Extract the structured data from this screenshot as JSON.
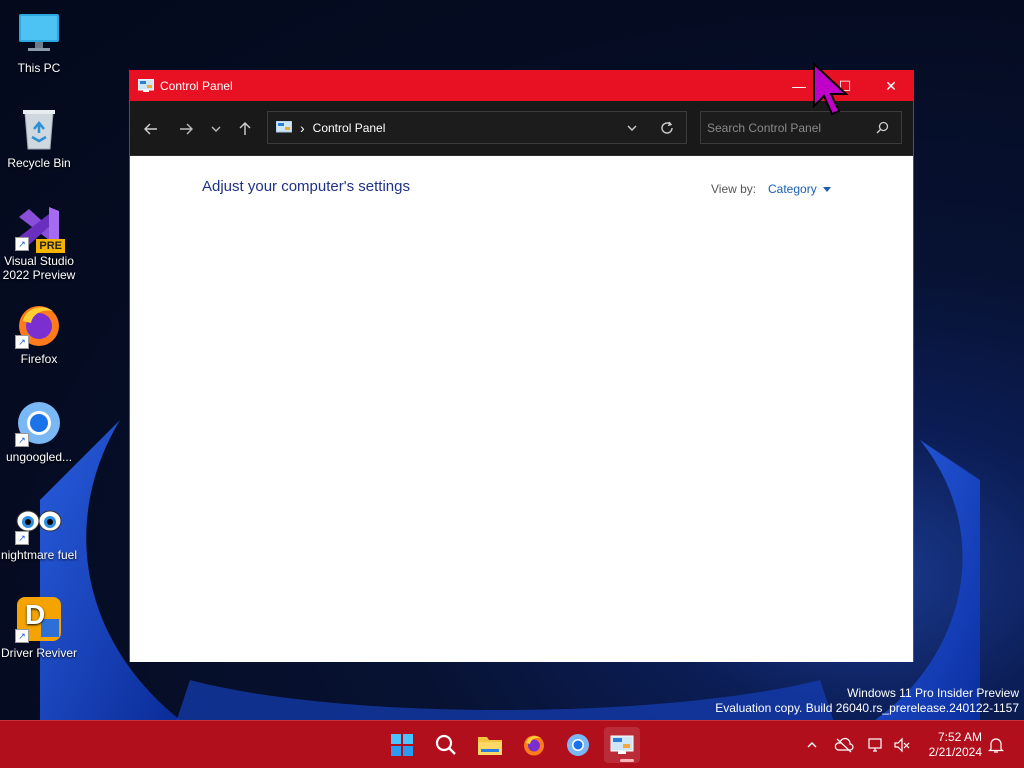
{
  "desktop": {
    "icons": [
      {
        "label": "This PC",
        "icon": "monitor-icon"
      },
      {
        "label": "Recycle Bin",
        "icon": "recycle-bin-icon"
      },
      {
        "label": "Visual Studio 2022 Preview",
        "icon": "visual-studio-icon",
        "badge": "PRE"
      },
      {
        "label": "Firefox",
        "icon": "firefox-icon"
      },
      {
        "label": "ungoogled...",
        "icon": "chromium-icon"
      },
      {
        "label": "nightmare fuel",
        "icon": "eyes-icon"
      },
      {
        "label": "Driver Reviver",
        "icon": "driver-reviver-icon",
        "badge": "D"
      }
    ]
  },
  "window": {
    "title": "Control Panel",
    "controls": {
      "minimize": "—",
      "maximize": "☐",
      "close": "✕"
    },
    "address": {
      "separator": "›",
      "crumb": "Control Panel"
    },
    "search": {
      "placeholder": "Search Control Panel"
    },
    "content": {
      "heading": "Adjust your computer's settings",
      "view_by_label": "View by:",
      "view_by_value": "Category"
    }
  },
  "taskbar": {
    "apps": [
      "start-icon",
      "search-icon",
      "file-explorer-icon",
      "firefox-icon",
      "chromium-icon",
      "control-panel-icon"
    ],
    "active_app": "control-panel-icon",
    "clock": {
      "time": "7:52 AM",
      "date": "2/21/2024"
    }
  },
  "watermark": {
    "line1": "Windows 11 Pro Insider Preview",
    "line2": "Evaluation copy. Build 26040.rs_prerelease.240122-1157"
  },
  "colors": {
    "accent": "#e81123",
    "taskbar": "#b10f1c",
    "link": "#1a5fb4",
    "heading": "#1e3287",
    "cursor": "#c000c8"
  }
}
